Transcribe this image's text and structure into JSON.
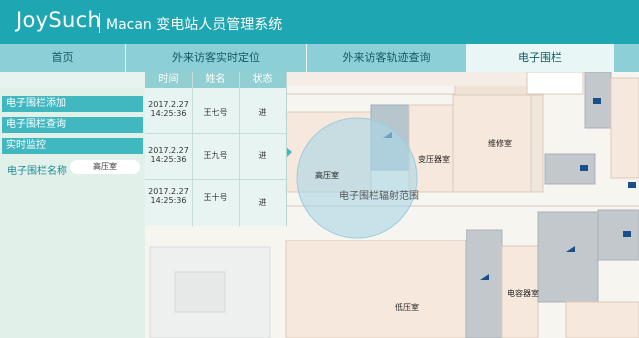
{
  "header": {
    "logo": "JoySuch",
    "title": "Macan 变电站人员管理系统"
  },
  "nav": {
    "tabs": [
      {
        "label": "首页"
      },
      {
        "label": "外来访客实时定位"
      },
      {
        "label": "外来访客轨迹查询"
      },
      {
        "label": "电子围栏"
      }
    ],
    "active_index": 3
  },
  "sidebar": {
    "items": [
      {
        "label": "电子围栏添加"
      },
      {
        "label": "电子围栏查询"
      },
      {
        "label": "实时监控"
      }
    ],
    "fence_name_label": "电子围栏名称",
    "fence_name_value": "高压室"
  },
  "table": {
    "headers": [
      "时间",
      "姓名",
      "状态"
    ],
    "rows": [
      {
        "date": "2017.2.27",
        "time": "14:25:36",
        "name": "王七号",
        "status": "进"
      },
      {
        "date": "2017.2.27",
        "time": "14:25:36",
        "name": "王九号",
        "status": "进"
      },
      {
        "date": "2017.2.27",
        "time": "14:25:36",
        "name": "王十号",
        "status": "进"
      }
    ]
  },
  "map": {
    "rooms": {
      "high_voltage": "高压室",
      "transformer": "变压器室",
      "maintenance": "维修室",
      "low_voltage": "低压室",
      "capacitor": "电容器室"
    },
    "fence_radius_label": "电子围栏辐射范围"
  },
  "colors": {
    "header": "#1fa6b3",
    "nav": "#8dcfd6",
    "sidebar_button": "#41b7c0",
    "fence_circle": "#a9d6e6"
  }
}
